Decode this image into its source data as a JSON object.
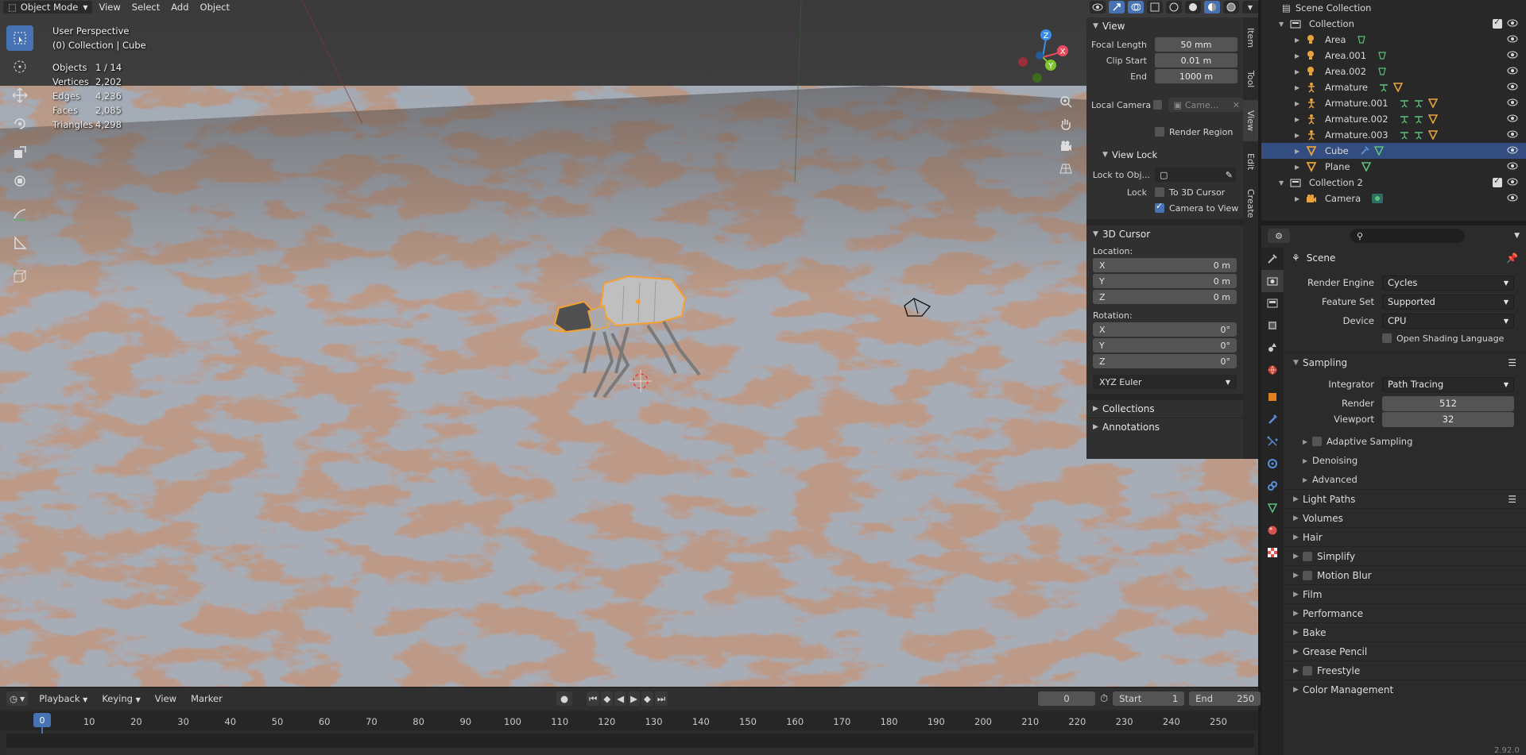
{
  "viewport": {
    "mode": "Object Mode",
    "menus": [
      "View",
      "Select",
      "Add",
      "Object"
    ],
    "perspective": "User Perspective",
    "collection_info": "(0) Collection | Cube",
    "stats": [
      {
        "label": "Objects",
        "value": "1 / 14"
      },
      {
        "label": "Vertices",
        "value": "2,202"
      },
      {
        "label": "Edges",
        "value": "4,236"
      },
      {
        "label": "Faces",
        "value": "2,085"
      },
      {
        "label": "Triangles",
        "value": "4,298"
      }
    ],
    "gizmo": {
      "x": "X",
      "y": "Y",
      "z": "Z"
    }
  },
  "npanel": {
    "tabs": [
      "Item",
      "Tool",
      "View",
      "Edit",
      "Create"
    ],
    "active_tab": "View",
    "view_section": "View",
    "focal_length_label": "Focal Length",
    "focal_length": "50 mm",
    "clip_start_label": "Clip Start",
    "clip_start": "0.01 m",
    "end_label": "End",
    "end": "1000 m",
    "local_camera_label": "Local Camera",
    "local_camera_value": "Came...",
    "render_region_label": "Render Region",
    "view_lock_section": "View Lock",
    "lock_to_obj_label": "Lock to Obj...",
    "lock_label": "Lock",
    "to_3d_cursor_label": "To 3D Cursor",
    "camera_to_view_label": "Camera to View",
    "cursor_section": "3D Cursor",
    "location_label": "Location:",
    "location": [
      {
        "axis": "X",
        "value": "0 m"
      },
      {
        "axis": "Y",
        "value": "0 m"
      },
      {
        "axis": "Z",
        "value": "0 m"
      }
    ],
    "rotation_label": "Rotation:",
    "rotation": [
      {
        "axis": "X",
        "value": "0°"
      },
      {
        "axis": "Y",
        "value": "0°"
      },
      {
        "axis": "Z",
        "value": "0°"
      }
    ],
    "rotation_mode": "XYZ Euler",
    "collections_section": "Collections",
    "annotations_section": "Annotations"
  },
  "timeline": {
    "menus": [
      "Playback",
      "Keying",
      "View",
      "Marker"
    ],
    "current_frame": "0",
    "start_label": "Start",
    "start": "1",
    "end_label": "End",
    "end": "250",
    "ruler": [
      "0",
      "10",
      "20",
      "30",
      "40",
      "50",
      "60",
      "70",
      "80",
      "90",
      "100",
      "110",
      "120",
      "130",
      "140",
      "150",
      "160",
      "170",
      "180",
      "190",
      "200",
      "210",
      "220",
      "230",
      "240",
      "250"
    ],
    "version": "2.92.0"
  },
  "outliner": {
    "title": "Scene Collection",
    "rows": [
      {
        "name": "Collection",
        "depth": 1,
        "icon": "collection-icon",
        "checkbox": true
      },
      {
        "name": "Area",
        "depth": 2,
        "icon": "light-icon",
        "extra": [
          "light-data-icon"
        ]
      },
      {
        "name": "Area.001",
        "depth": 2,
        "icon": "light-icon",
        "extra": [
          "light-data-icon"
        ]
      },
      {
        "name": "Area.002",
        "depth": 2,
        "icon": "light-icon",
        "extra": [
          "light-data-icon"
        ]
      },
      {
        "name": "Armature",
        "depth": 2,
        "icon": "armature-icon",
        "extra": [
          "armature-data-icon",
          "mesh-icon"
        ]
      },
      {
        "name": "Armature.001",
        "depth": 2,
        "icon": "armature-icon",
        "extra": [
          "armature-data-icon",
          "pose-icon",
          "mesh-icon"
        ]
      },
      {
        "name": "Armature.002",
        "depth": 2,
        "icon": "armature-icon",
        "extra": [
          "armature-data-icon",
          "pose-icon",
          "mesh-icon"
        ]
      },
      {
        "name": "Armature.003",
        "depth": 2,
        "icon": "armature-icon",
        "extra": [
          "armature-data-icon",
          "pose-icon",
          "mesh-icon"
        ]
      },
      {
        "name": "Cube",
        "depth": 2,
        "icon": "mesh-object-icon",
        "extra": [
          "modifier-icon",
          "mesh-data-icon"
        ],
        "selected": true
      },
      {
        "name": "Plane",
        "depth": 2,
        "icon": "mesh-object-icon",
        "extra": [
          "mesh-data-icon"
        ]
      },
      {
        "name": "Collection 2",
        "depth": 1,
        "icon": "collection-icon",
        "checkbox": true
      },
      {
        "name": "Camera",
        "depth": 2,
        "icon": "camera-icon",
        "extra": [
          "camera-data-icon"
        ]
      }
    ]
  },
  "properties": {
    "scene_label": "Scene",
    "render_engine_label": "Render Engine",
    "render_engine": "Cycles",
    "feature_set_label": "Feature Set",
    "feature_set": "Supported",
    "device_label": "Device",
    "device": "CPU",
    "osl_label": "Open Shading Language",
    "sampling_section": "Sampling",
    "integrator_label": "Integrator",
    "integrator": "Path Tracing",
    "render_label": "Render",
    "render_samples": "512",
    "viewport_label": "Viewport",
    "viewport_samples": "32",
    "sub_sections": [
      {
        "label": "Adaptive Sampling",
        "checkbox": true
      },
      {
        "label": "Denoising",
        "checkbox": false
      },
      {
        "label": "Advanced",
        "checkbox": false
      }
    ],
    "sections": [
      {
        "label": "Light Paths",
        "checkbox": false,
        "list": true
      },
      {
        "label": "Volumes",
        "checkbox": false
      },
      {
        "label": "Hair",
        "checkbox": false
      },
      {
        "label": "Simplify",
        "checkbox": true
      },
      {
        "label": "Motion Blur",
        "checkbox": true
      },
      {
        "label": "Film",
        "checkbox": false
      },
      {
        "label": "Performance",
        "checkbox": false
      },
      {
        "label": "Bake",
        "checkbox": false
      },
      {
        "label": "Grease Pencil",
        "checkbox": false
      },
      {
        "label": "Freestyle",
        "checkbox": true
      },
      {
        "label": "Color Management",
        "checkbox": false
      }
    ]
  },
  "colors": {
    "accent": "#4772b3",
    "selection_orange": "#f5a030",
    "selected_row": "#334d80",
    "axis_x": "#e84a5f",
    "axis_y": "#7ec431",
    "axis_z": "#3a8ee6"
  }
}
